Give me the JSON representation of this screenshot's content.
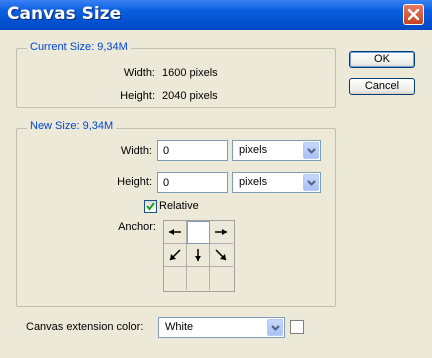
{
  "window": {
    "title": "Canvas Size",
    "close_icon": "close-icon"
  },
  "buttons": {
    "ok": "OK",
    "cancel": "Cancel"
  },
  "current_size": {
    "legend": "Current Size: 9,34M",
    "width_label": "Width:",
    "width_value": "1600 pixels",
    "height_label": "Height:",
    "height_value": "2040 pixels"
  },
  "new_size": {
    "legend": "New Size: 9,34M",
    "width_label": "Width:",
    "width_value": "0",
    "width_unit": "pixels",
    "height_label": "Height:",
    "height_value": "0",
    "height_unit": "pixels",
    "relative_label": "Relative",
    "relative_checked": true,
    "anchor_label": "Anchor:",
    "anchor_selected": "center"
  },
  "extension": {
    "label": "Canvas extension color:",
    "value": "White",
    "swatch_color": "#ffffff"
  },
  "colors": {
    "titlebar": "#0a5fe0",
    "dialog_bg": "#ece9d8",
    "group_label": "#0046d5"
  }
}
